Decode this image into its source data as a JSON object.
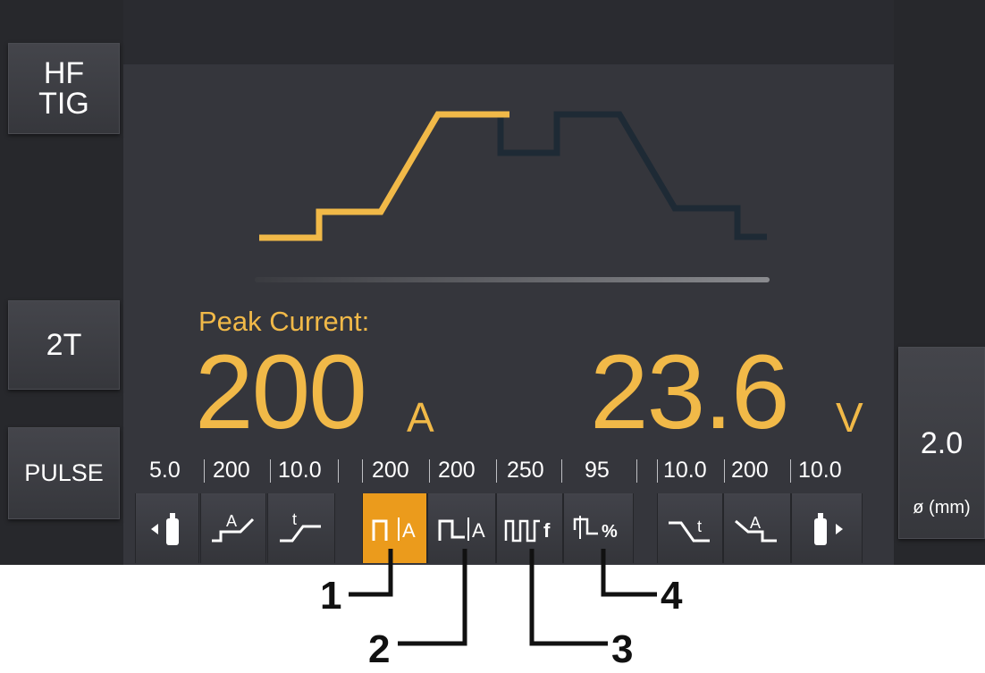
{
  "left_buttons": {
    "mode_line1": "HF",
    "mode_line2": "TIG",
    "trigger": "2T",
    "pulse": "PULSE"
  },
  "display": {
    "parameter_label": "Peak Current:",
    "current_value": "200",
    "current_unit": "A",
    "voltage_value": "23.6",
    "voltage_unit": "V"
  },
  "electrode": {
    "value": "2.0",
    "unit_label": "ø (mm)"
  },
  "parameter_values": [
    "5.0",
    "200",
    "10.0",
    "200",
    "200",
    "250",
    "95",
    "10.0",
    "200",
    "10.0"
  ],
  "parameter_icons": [
    {
      "name": "pre-gas-icon",
      "text": ""
    },
    {
      "name": "start-current-icon",
      "text": "A"
    },
    {
      "name": "upslope-time-icon",
      "text": "t"
    },
    {
      "name": "peak-current-icon",
      "text": "A",
      "active": true
    },
    {
      "name": "base-current-icon",
      "text": "A"
    },
    {
      "name": "pulse-frequency-icon",
      "text": "f"
    },
    {
      "name": "pulse-duty-icon",
      "text": "%"
    },
    {
      "name": "downslope-time-icon",
      "text": "t"
    },
    {
      "name": "crater-current-icon",
      "text": "A"
    },
    {
      "name": "post-gas-icon",
      "text": ""
    }
  ],
  "colors": {
    "accent": "#f1b948",
    "active_button": "#eb9b1c",
    "panel": "#35363c",
    "waveform_inactive": "#1e2a35"
  },
  "callouts": [
    "1",
    "2",
    "3",
    "4"
  ]
}
